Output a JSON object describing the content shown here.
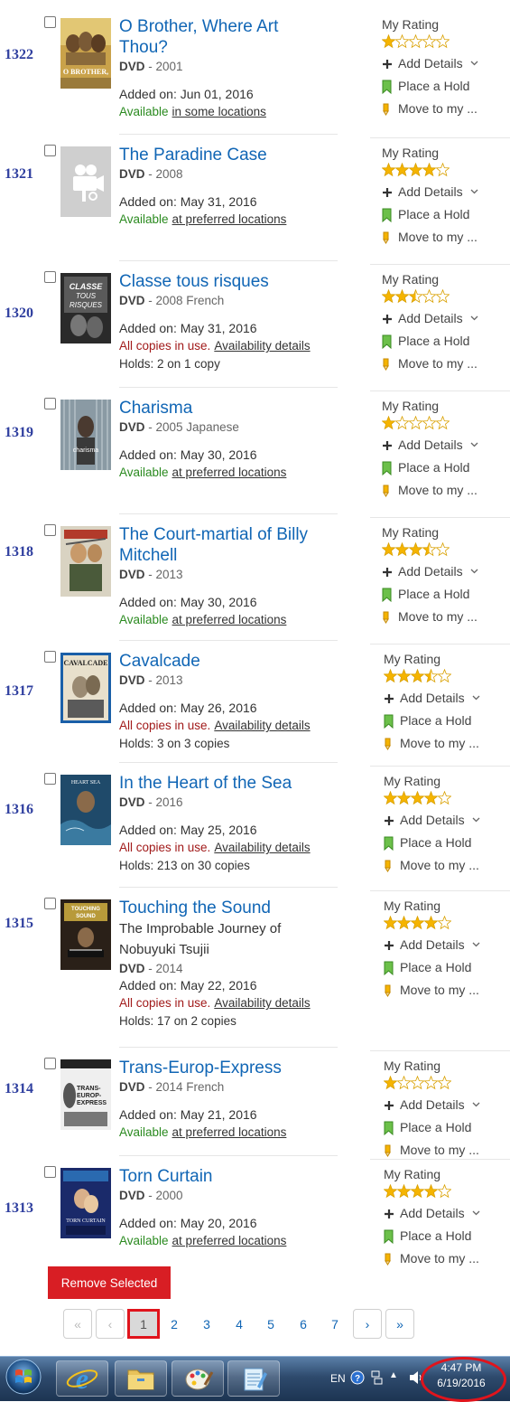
{
  "items": [
    {
      "row": "1322",
      "title": [
        "O Brother, Where Art",
        "Thou?"
      ],
      "subtitle": [],
      "format": "DVD",
      "meta": "2001",
      "added": "Added on: Jun 01, 2016",
      "status_type": "available",
      "status_text": "Available",
      "status_link": "in some locations",
      "holds": "",
      "rating_label": "My Rating",
      "stars": 1,
      "cover": "obrother",
      "actions": [
        "Add Details",
        "Place a Hold",
        "Move to my ..."
      ]
    },
    {
      "row": "1321",
      "title": [
        "The Paradine Case"
      ],
      "subtitle": [],
      "format": "DVD",
      "meta": "2008",
      "added": "Added on: May 31, 2016",
      "status_type": "available",
      "status_text": "Available",
      "status_link": "at preferred locations",
      "holds": "",
      "rating_label": "My Rating",
      "stars": 4,
      "cover": "placeholder",
      "actions": [
        "Add Details",
        "Place a Hold",
        "Move to my ..."
      ]
    },
    {
      "row": "1320",
      "title": [
        "Classe tous risques"
      ],
      "subtitle": [],
      "format": "DVD",
      "meta": "2008 French",
      "added": "Added on: May 31, 2016",
      "status_type": "inuse",
      "status_text": "All copies in use.",
      "status_link": "Availability details",
      "holds": "Holds: 2 on 1 copy",
      "rating_label": "My Rating",
      "stars": 2.5,
      "cover": "classe",
      "actions": [
        "Add Details",
        "Place a Hold",
        "Move to my ..."
      ]
    },
    {
      "row": "1319",
      "title": [
        "Charisma"
      ],
      "subtitle": [],
      "format": "DVD",
      "meta": "2005 Japanese",
      "added": "Added on: May 30, 2016",
      "status_type": "available",
      "status_text": "Available",
      "status_link": "at preferred locations",
      "holds": "",
      "rating_label": "My Rating",
      "stars": 1,
      "cover": "charisma",
      "actions": [
        "Add Details",
        "Place a Hold",
        "Move to my ..."
      ]
    },
    {
      "row": "1318",
      "title": [
        "The Court-martial of Billy",
        "Mitchell"
      ],
      "subtitle": [],
      "format": "DVD",
      "meta": "2013",
      "added": "Added on: May 30, 2016",
      "status_type": "available",
      "status_text": "Available",
      "status_link": "at preferred locations",
      "holds": "",
      "rating_label": "My Rating",
      "stars": 3.5,
      "cover": "courtmartial",
      "actions": [
        "Add Details",
        "Place a Hold",
        "Move to my ..."
      ]
    },
    {
      "row": "1317",
      "title": [
        "Cavalcade"
      ],
      "subtitle": [],
      "format": "DVD",
      "meta": "2013",
      "added": "Added on: May 26, 2016",
      "status_type": "inuse",
      "status_text": "All copies in use.",
      "status_link": "Availability details",
      "holds": "Holds: 3 on 3 copies",
      "rating_label": "My Rating",
      "stars": 3.5,
      "cover": "cavalcade",
      "actions": [
        "Add Details",
        "Place a Hold",
        "Move to my ..."
      ]
    },
    {
      "row": "1316",
      "title": [
        "In the Heart of the Sea"
      ],
      "subtitle": [],
      "format": "DVD",
      "meta": "2016",
      "added": "Added on: May 25, 2016",
      "status_type": "inuse",
      "status_text": "All copies in use.",
      "status_link": "Availability details",
      "holds": "Holds: 213 on 30 copies",
      "rating_label": "My Rating",
      "stars": 4,
      "cover": "heartsea",
      "actions": [
        "Add Details",
        "Place a Hold",
        "Move to my ..."
      ]
    },
    {
      "row": "1315",
      "title": [
        "Touching the Sound"
      ],
      "subtitle": [
        "The Improbable Journey of",
        "Nobuyuki Tsujii"
      ],
      "format": "DVD",
      "meta": "2014",
      "added": "Added on: May 22, 2016",
      "status_type": "inuse",
      "status_text": "All copies in use.",
      "status_link": "Availability details",
      "holds": "Holds: 17 on 2 copies",
      "rating_label": "My Rating",
      "stars": 4,
      "cover": "touching",
      "actions": [
        "Add Details",
        "Place a Hold",
        "Move to my ..."
      ]
    },
    {
      "row": "1314",
      "title": [
        "Trans-Europ-Express"
      ],
      "subtitle": [],
      "format": "DVD",
      "meta": "2014 French",
      "added": "Added on: May 21, 2016",
      "status_type": "available",
      "status_text": "Available",
      "status_link": "at preferred locations",
      "holds": "",
      "rating_label": "My Rating",
      "stars": 1,
      "cover": "transeurop",
      "actions": [
        "Add Details",
        "Place a Hold",
        "Move to my ..."
      ]
    },
    {
      "row": "1313",
      "title": [
        "Torn Curtain"
      ],
      "subtitle": [],
      "format": "DVD",
      "meta": "2000",
      "added": "Added on: May 20, 2016",
      "status_type": "available",
      "status_text": "Available",
      "status_link": "at preferred locations",
      "holds": "",
      "rating_label": "My Rating",
      "stars": 4,
      "cover": "torncurtain",
      "actions": [
        "Add Details",
        "Place a Hold",
        "Move to my ..."
      ]
    }
  ],
  "remove_button": "Remove Selected",
  "pagination": {
    "first": "«",
    "prev": "‹",
    "next": "›",
    "last": "»",
    "pages": [
      "1",
      "2",
      "3",
      "4",
      "5",
      "6",
      "7"
    ],
    "current": "1"
  },
  "taskbar": {
    "language": "EN",
    "time": "4:47 PM",
    "date": "6/19/2016",
    "apps": [
      "internet-explorer-icon",
      "file-explorer-icon",
      "paint-icon",
      "notepad-icon"
    ]
  },
  "colors": {
    "title_link": "#1166b5",
    "available": "#2a8a1f",
    "in_use": "#a11a1a",
    "star": "#f5b400",
    "remove_button": "#d81e24",
    "row_number": "#2f3f9f"
  }
}
